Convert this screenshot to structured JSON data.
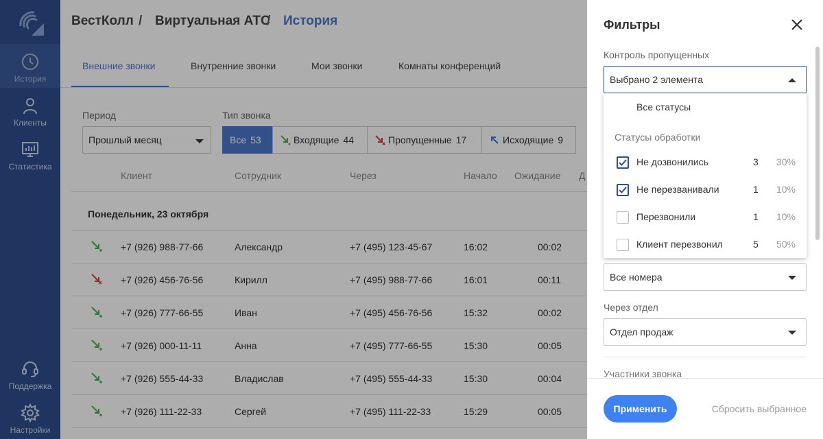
{
  "sidebar": {
    "items": [
      {
        "label": "История",
        "icon": "clock-icon"
      },
      {
        "label": "Клиенты",
        "icon": "person-icon"
      },
      {
        "label": "Статистика",
        "icon": "chart-icon"
      },
      {
        "label": "Поддержка",
        "icon": "headset-icon"
      },
      {
        "label": "Настройки",
        "icon": "gear-icon"
      }
    ]
  },
  "breadcrumb": {
    "company": "ВестКолл",
    "sep": "/",
    "section": "Виртуальная АТС",
    "current": "История"
  },
  "tabs": [
    "Внешние звонки",
    "Внутренние звонки",
    "Мои звонки",
    "Комнаты конференций"
  ],
  "filters": {
    "period_label": "Период",
    "period_value": "Прошлый месяц",
    "type_label": "Тип звонка",
    "types": [
      {
        "label": "Все",
        "count": "53"
      },
      {
        "label": "Входящие",
        "count": "44"
      },
      {
        "label": "Пропущенные",
        "count": "17"
      },
      {
        "label": "Исходящие",
        "count": "9"
      }
    ]
  },
  "table": {
    "headers": [
      "Клиент",
      "Сотрудник",
      "Через",
      "Начало",
      "Ожидание",
      "Д"
    ],
    "day": "Понедельник, 23 октября",
    "rows": [
      {
        "type": "incoming",
        "client": "+7 (926) 988-77-66",
        "employee": "Александр",
        "via": "+7 (495) 123-45-67",
        "start": "16:02",
        "wait": "00:02"
      },
      {
        "type": "missed",
        "client": "+7 (926) 456-76-56",
        "employee": "Кирилл",
        "via": "+7 (495) 988-77-66",
        "start": "16:01",
        "wait": "00:11"
      },
      {
        "type": "incoming",
        "client": "+7 (926) 777-66-55",
        "employee": "Иван",
        "via": "+7 (495) 456-76-56",
        "start": "15:32",
        "wait": "00:02"
      },
      {
        "type": "incoming",
        "client": "+7 (926) 000-11-11",
        "employee": "Анна",
        "via": "+7 (495) 777-66-55",
        "start": "15:30",
        "wait": "00:05"
      },
      {
        "type": "incoming",
        "client": "+7 (926) 555-44-33",
        "employee": "Владислав",
        "via": "+7 (495) 555-44-33",
        "start": "15:30",
        "wait": "00:04"
      },
      {
        "type": "incoming",
        "client": "+7 (926) 111-22-33",
        "employee": "Сергей",
        "via": "+7 (495) 111-22-33",
        "start": "15:29",
        "wait": "00:05"
      }
    ]
  },
  "panel": {
    "title": "Фильтры",
    "missed_label": "Контроль пропущенных",
    "missed_value": "Выбрано 2 элемента",
    "dropdown": {
      "all": "Все статусы",
      "section": "Статусы обработки",
      "items": [
        {
          "label": "Не дозвонились",
          "count": "3",
          "pct": "30%",
          "checked": true
        },
        {
          "label": "Не перезванивали",
          "count": "1",
          "pct": "10%",
          "checked": true
        },
        {
          "label": "Перезвонили",
          "count": "1",
          "pct": "10%",
          "checked": false
        },
        {
          "label": "Клиент перезвонил",
          "count": "5",
          "pct": "50%",
          "checked": false
        }
      ]
    },
    "numbers_value": "Все номера",
    "dept_label": "Через отдел",
    "dept_value": "Отдел продаж",
    "participants_label": "Участники звонка",
    "apply": "Применить",
    "reset": "Сбросить выбранное"
  },
  "colors": {
    "sidebar": "#2f4f8c",
    "accent": "#4a78c9",
    "apply": "#3d82f0",
    "incoming": "#4caf50",
    "missed": "#e53935"
  }
}
